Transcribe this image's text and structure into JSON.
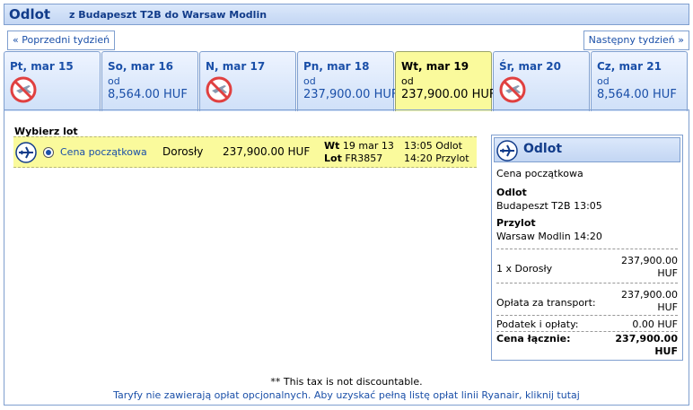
{
  "header": {
    "title": "Odlot",
    "route": "z Budapeszt T2B do Warsaw Modlin"
  },
  "nav": {
    "prev_label": "« Poprzedni tydzień",
    "next_label": "Następny tydzień »"
  },
  "days": [
    {
      "label": "Pt, mar 15",
      "available": false,
      "od": "",
      "price": ""
    },
    {
      "label": "So, mar 16",
      "available": true,
      "od": "od",
      "price": "8,564.00 HUF"
    },
    {
      "label": "N, mar 17",
      "available": false,
      "od": "",
      "price": ""
    },
    {
      "label": "Pn, mar 18",
      "available": true,
      "od": "od",
      "price": "237,900.00 HUF"
    },
    {
      "label": "Wt, mar 19",
      "available": true,
      "od": "od",
      "price": "237,900.00 HUF",
      "selected": true
    },
    {
      "label": "Śr, mar 20",
      "available": false,
      "od": "",
      "price": ""
    },
    {
      "label": "Cz, mar 21",
      "available": true,
      "od": "od",
      "price": "8,564.00 HUF"
    }
  ],
  "flights": {
    "heading": "Wybierz lot",
    "row": {
      "fare": "Cena początkowa",
      "pax": "Dorosły",
      "amount": "237,900.00 HUF",
      "day_label": "Wt",
      "date": "19 mar 13",
      "flight_label": "Lot",
      "flight_no": "FR3857",
      "dep_time": "13:05 Odlot",
      "arr_time": "14:20 Przylot"
    }
  },
  "summary": {
    "title": "Odlot",
    "fare": "Cena początkowa",
    "dep_label": "Odlot",
    "dep_value": "Budapeszt T2B 13:05",
    "arr_label": "Przylot",
    "arr_value": "Warsaw Modlin 14:20",
    "pax_label": "1 x Dorosły",
    "pax_amount": "237,900.00",
    "pax_currency": "HUF",
    "transport_label": "Opłata za transport:",
    "transport_amount": "237,900.00",
    "transport_currency": "HUF",
    "tax_label": "Podatek i opłaty:",
    "tax_amount": "0.00 HUF",
    "total_label": "Cena łącznie:",
    "total_amount": "237,900.00",
    "total_currency": "HUF"
  },
  "footer": {
    "note": "** This tax is not discountable.",
    "link": "Taryfy nie zawierają opłat opcjonalnych. Aby uzyskać pełną listę opłat linii Ryanair, kliknij tutaj"
  },
  "icons": {
    "plane": "plane-icon",
    "no_flight": "no-flight-icon"
  },
  "colors": {
    "accent": "#1a4fa8",
    "selected": "#fafa9c",
    "header": "#c3d6f3"
  }
}
